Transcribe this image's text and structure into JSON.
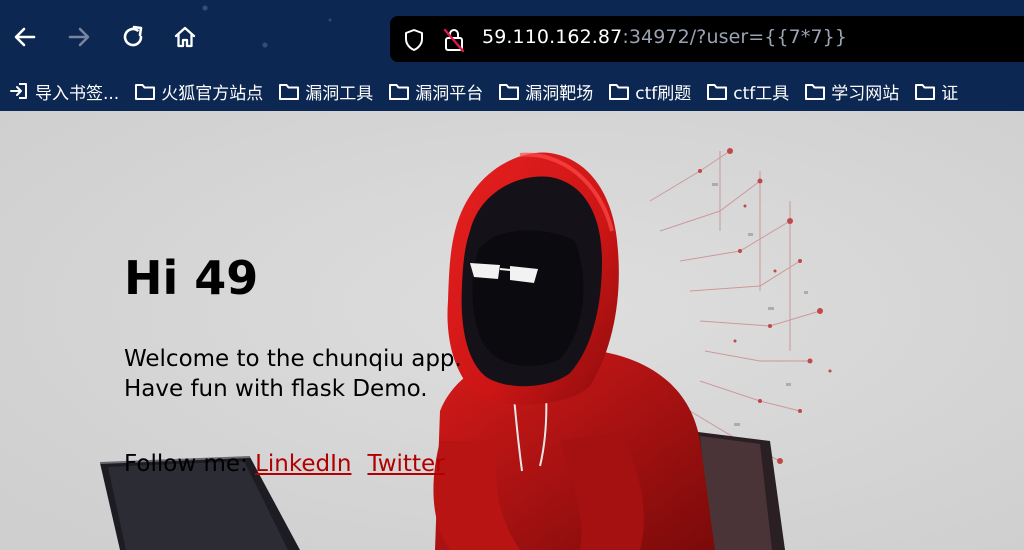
{
  "browser": {
    "url_host": "59.110.162.87",
    "url_rest": ":34972/?user={{7*7}}",
    "bookmarks": [
      {
        "label": "导入书签...",
        "icon": "import-icon"
      },
      {
        "label": "火狐官方站点",
        "icon": "folder-icon"
      },
      {
        "label": "漏洞工具",
        "icon": "folder-icon"
      },
      {
        "label": "漏洞平台",
        "icon": "folder-icon"
      },
      {
        "label": "漏洞靶场",
        "icon": "folder-icon"
      },
      {
        "label": "ctf刷题",
        "icon": "folder-icon"
      },
      {
        "label": "ctf工具",
        "icon": "folder-icon"
      },
      {
        "label": "学习网站",
        "icon": "folder-icon"
      },
      {
        "label": "证",
        "icon": "folder-icon"
      }
    ]
  },
  "page": {
    "greeting": "Hi 49",
    "welcome_line1": "Welcome to the chunqiu app.",
    "welcome_line2": "Have fun with flask Demo.",
    "follow_label": "Follow me: ",
    "links": [
      "LinkedIn",
      "Twitter"
    ]
  },
  "colors": {
    "chrome_bg": "#0c2751",
    "link": "#b10000",
    "hood_red": "#d71818"
  }
}
